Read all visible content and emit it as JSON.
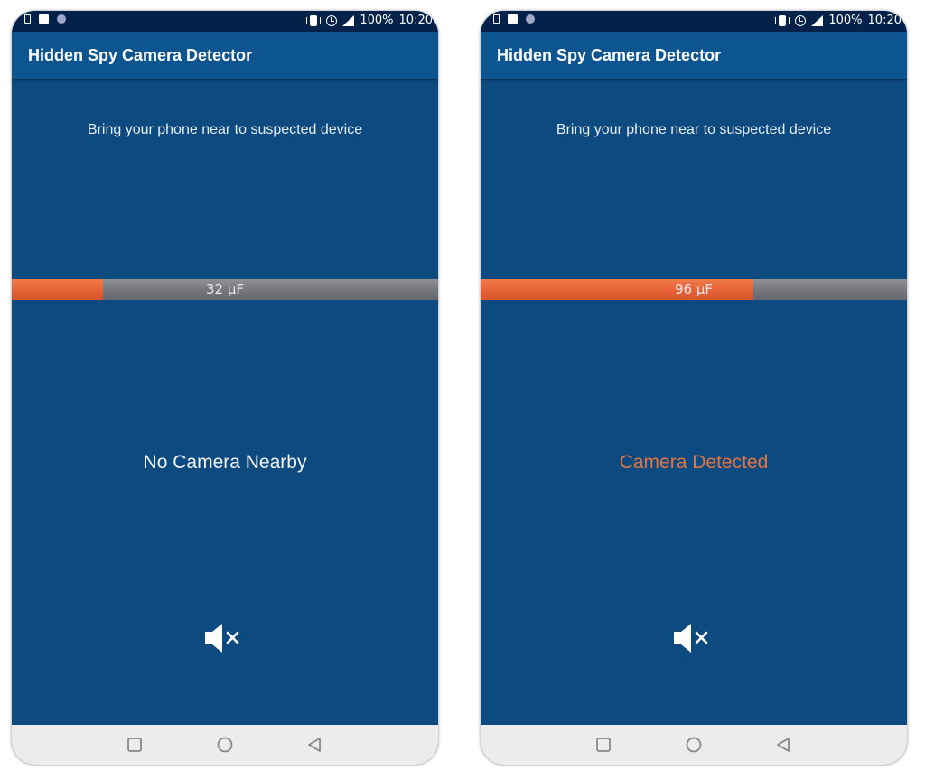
{
  "phones": [
    {
      "status_bar": {
        "battery": "100%",
        "time": "10:20"
      },
      "app_title": "Hidden Spy Camera Detector",
      "instruction": "Bring your phone near to suspected device",
      "meter": {
        "label": "32 μF",
        "value": 32,
        "max": 150,
        "fill_color": "#e4603a"
      },
      "status_message": "No Camera Nearby",
      "status_color": "#f4f6f9"
    },
    {
      "status_bar": {
        "battery": "100%",
        "time": "10:20"
      },
      "app_title": "Hidden Spy Camera Detector",
      "instruction": "Bring your phone near to suspected device",
      "meter": {
        "label": "96 μF",
        "value": 96,
        "max": 150,
        "fill_color": "#e4603a"
      },
      "status_message": "Camera Detected",
      "status_color": "#e6743f"
    }
  ],
  "icons": {
    "status_left": [
      "sim-icon",
      "image-icon",
      "notification-dot-icon"
    ],
    "status_right": [
      "vibrate-icon",
      "alarm-icon",
      "signal-icon"
    ],
    "mute": "speaker-muted-icon",
    "nav": [
      "recents-square-icon",
      "home-circle-icon",
      "back-triangle-icon"
    ]
  },
  "colors": {
    "status_bar": "#04214a",
    "app_bar": "#0d5590",
    "background": "#0d4a80",
    "meter_track": "#76787d",
    "nav_bar": "#ececec"
  }
}
